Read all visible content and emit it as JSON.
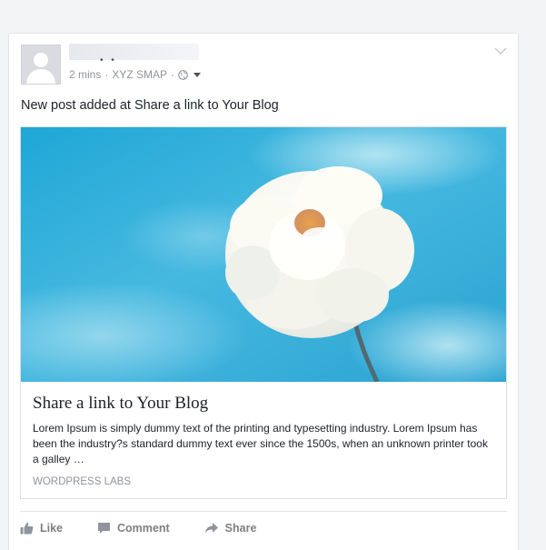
{
  "post": {
    "author_name": "",
    "timestamp": "2 mins",
    "app_name": "XYZ SMAP",
    "audience_icon": "globe-icon",
    "text": "New post added at Share a link to Your Blog"
  },
  "link_preview": {
    "image_subject": "white flower against blue sky",
    "title": "Share a link to Your Blog",
    "description": "Lorem Ipsum is simply dummy text of the printing and typesetting industry. Lorem Ipsum has been the industry?s standard dummy text ever since the 1500s, when an unknown printer took a galley …",
    "domain": "WORDPRESS LABS"
  },
  "actions": {
    "like_label": "Like",
    "comment_label": "Comment",
    "share_label": "Share"
  },
  "colors": {
    "page_bg": "#f3f4f6",
    "meta_text": "#90949c",
    "action_text": "#7f7f7f",
    "sky_blue": "#2aa9d6"
  }
}
